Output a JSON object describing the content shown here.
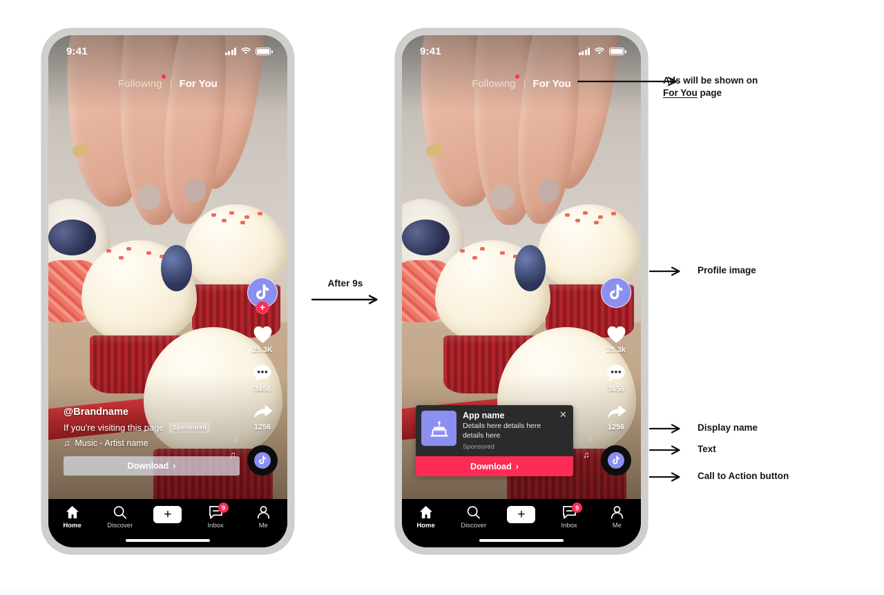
{
  "page": {
    "middle_label": "After 9s"
  },
  "phone_left": {
    "status": {
      "clock": "9:41",
      "signal_icon": "cellular-bars-icon",
      "wifi_icon": "wifi-icon",
      "battery_icon": "battery-full-icon"
    },
    "tabs": {
      "following": "Following",
      "for_you": "For You"
    },
    "rail": {
      "avatar_icon": "tiktok-note-icon",
      "follow_plus": "+",
      "like_icon": "heart-icon",
      "like_count": "25.3K",
      "comment_icon": "comment-bubble-icon",
      "comment_count": "3456",
      "share_icon": "share-arrow-icon",
      "share_count": "1256",
      "disc_icon": "music-disc-icon"
    },
    "caption": {
      "username": "@Brandname",
      "text": "If you're visiting this page",
      "sponsored": "Sponsored",
      "music_icon": "music-note-icon",
      "music": "Music - Artist name",
      "cta_label": "Download",
      "cta_chevron": "›"
    },
    "nav": {
      "home": "Home",
      "discover": "Discover",
      "create_icon": "plus-icon",
      "inbox": "Inbox",
      "inbox_badge": "9",
      "me": "Me"
    }
  },
  "phone_right": {
    "status": {
      "clock": "9:41",
      "signal_icon": "cellular-bars-icon",
      "wifi_icon": "wifi-icon",
      "battery_icon": "battery-full-icon"
    },
    "tabs": {
      "following": "Following",
      "for_you": "For You"
    },
    "rail": {
      "avatar_icon": "tiktok-note-icon",
      "like_icon": "heart-icon",
      "like_count": "25.3k",
      "comment_icon": "comment-bubble-icon",
      "comment_count": "3456",
      "share_icon": "share-arrow-icon",
      "share_count": "1256",
      "disc_icon": "music-disc-icon"
    },
    "ad_card": {
      "app_icon": "birthday-cake-icon",
      "title": "App name",
      "description": "Details here details here details here",
      "sponsored": "Sponsored",
      "close_icon": "close-icon",
      "cta_label": "Download",
      "cta_chevron": "›"
    },
    "nav": {
      "home": "Home",
      "discover": "Discover",
      "create_icon": "plus-icon",
      "inbox": "Inbox",
      "inbox_badge": "9",
      "me": "Me"
    }
  },
  "annotations": [
    {
      "line1": "Ads will be shown on",
      "underlined": "For You",
      "line2_tail": " page"
    },
    {
      "label": "Profile image"
    },
    {
      "label": "Display name"
    },
    {
      "label": "Text"
    },
    {
      "label": "Call to Action button"
    }
  ],
  "colors": {
    "brand_red": "#fe2c55",
    "brand_cyan": "#25f4ee",
    "accent_purple": "#8b8ff0",
    "card_dark": "#2b2b2b",
    "nav_black": "#000000",
    "frame_gray": "#cfcfce",
    "text_black": "#141414"
  }
}
